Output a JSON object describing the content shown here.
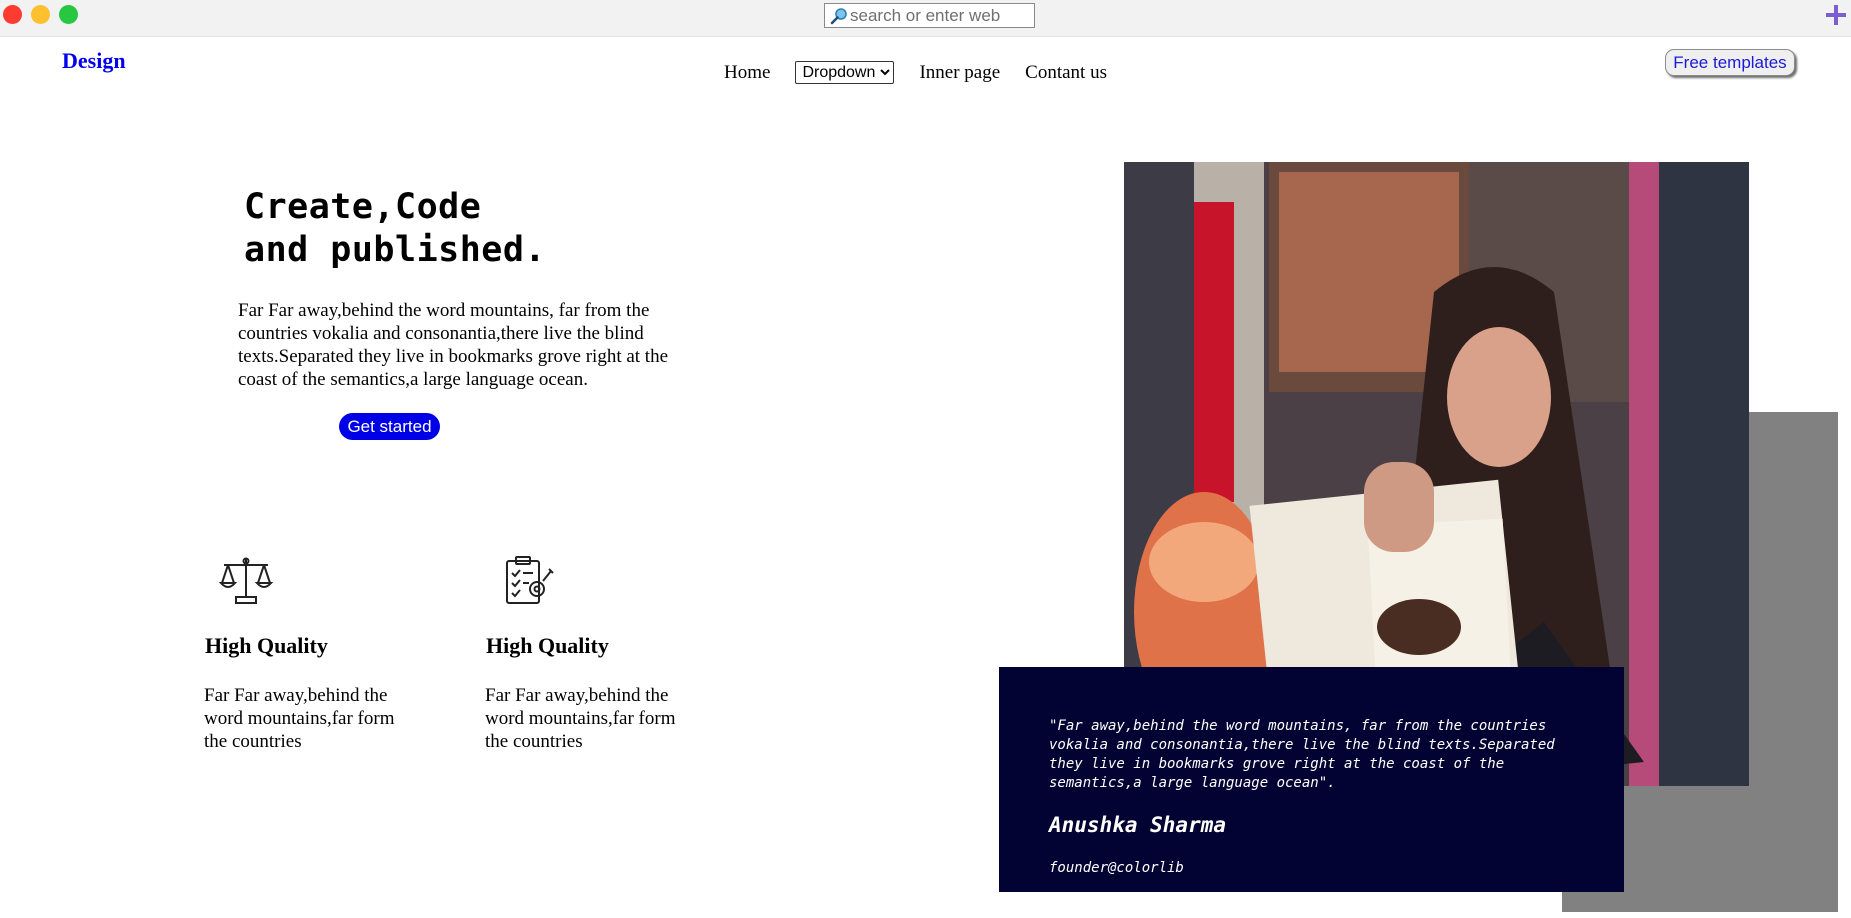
{
  "browser": {
    "address_placeholder": "search or enter web"
  },
  "nav": {
    "logo": "Design",
    "links": [
      "Home",
      "Inner page",
      "Contant us"
    ],
    "dropdown_selected": "Dropdown",
    "cta": "Free templates"
  },
  "hero": {
    "title_line1": "Create,Code",
    "title_line2": "and published.",
    "description": "Far Far away,behind the word mountains, far from the countries vokalia and consonantia,there live the blind texts.Separated they live in bookmarks grove right at the coast of the semantics,a large language ocean.",
    "button": "Get started"
  },
  "features": [
    {
      "icon": "scales-icon",
      "title": "High Quality",
      "text": "Far Far away,behind the word mountains,far form the countries"
    },
    {
      "icon": "clipboard-gear-icon",
      "title": "High Quality",
      "text": "Far Far away,behind the word mountains,far form the countries"
    }
  ],
  "testimonial": {
    "quote": "\"Far away,behind the word mountains, far from the countries vokalia and consonantia,there live the blind texts.Separated they live in bookmarks grove right at the coast of the semantics,a large language ocean\".",
    "name": "Anushka Sharma",
    "role": "founder@colorlib"
  },
  "colors": {
    "brand_blue": "#0000e6",
    "quote_card_bg": "#030333",
    "gray_block": "#818181"
  }
}
